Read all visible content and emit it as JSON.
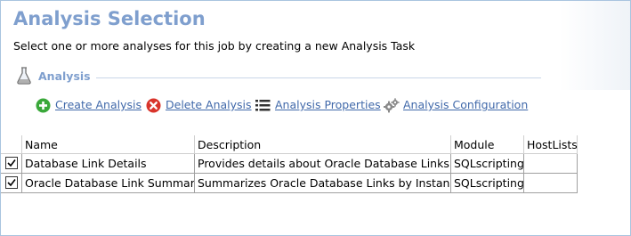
{
  "header": {
    "title": "Analysis Selection",
    "subtitle": "Select one or more analyses for this job by creating a new Analysis Task"
  },
  "section": {
    "label": "Analysis",
    "icon": "flask-icon"
  },
  "toolbar": {
    "create_label": "Create Analysis",
    "delete_label": "Delete Analysis",
    "properties_label": "Analysis Properties",
    "configuration_label": "Analysis Configuration"
  },
  "table": {
    "columns": [
      "Name",
      "Description",
      "Module",
      "HostLists"
    ],
    "rows": [
      {
        "checked": true,
        "name": "Database Link Details",
        "description": "Provides details about Oracle Database Links",
        "module": "SQLscripting",
        "hostlists": ""
      },
      {
        "checked": true,
        "name": "Oracle Database Link Summary",
        "description": "Summarizes Oracle Database Links by Instance",
        "module": "SQLscripting",
        "hostlists": ""
      }
    ]
  },
  "colors": {
    "accent": "#7f9fce",
    "link": "#4169aa",
    "create_icon": "#3aa83a",
    "delete_icon": "#d9342b"
  }
}
